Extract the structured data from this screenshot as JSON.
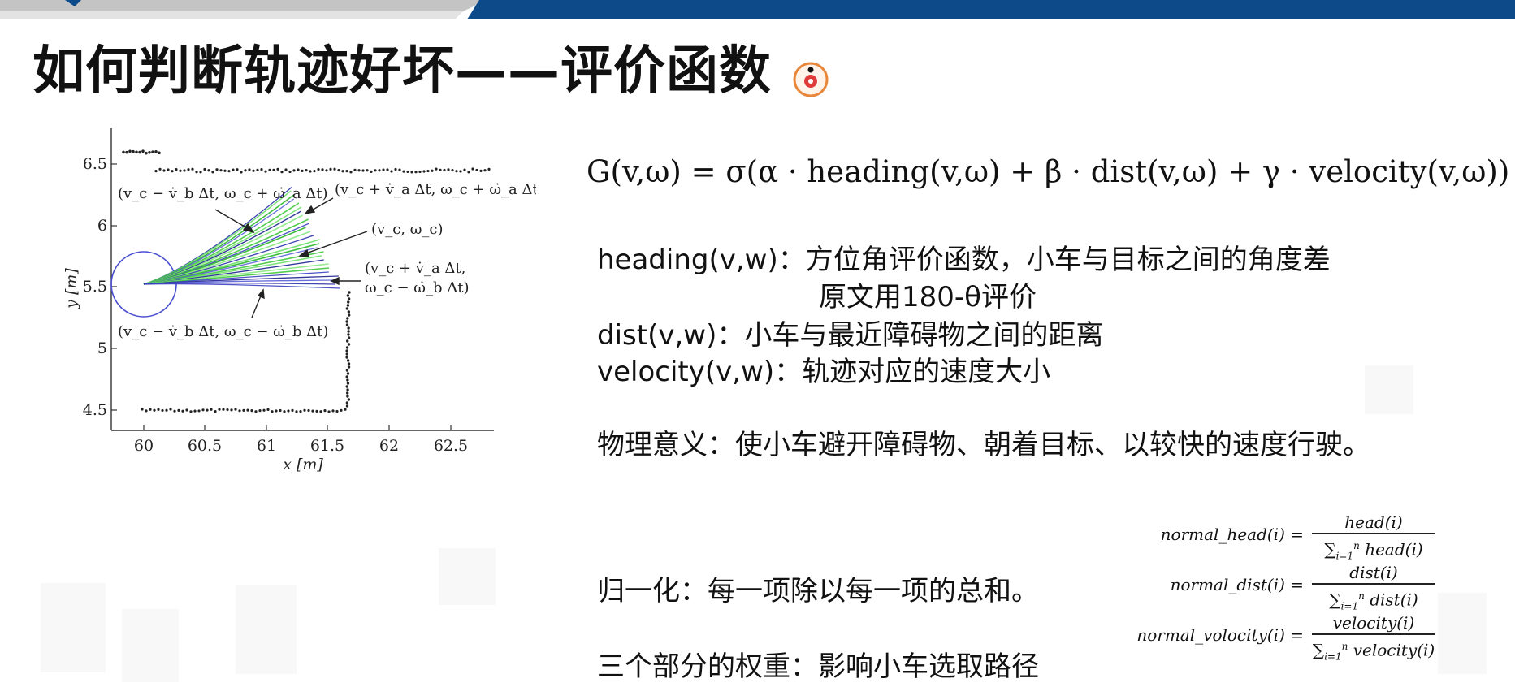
{
  "slide": {
    "title": "如何判断轨迹好坏——评价函数",
    "formula": "G(v,ω) = σ(α · heading(v,ω) + β · dist(v,ω) + γ · velocity(v,ω))",
    "items": [
      {
        "label": "heading(v,w)：方位角评价函数，小车与目标之间的角度差"
      },
      {
        "label": "原文用180-θ评价"
      },
      {
        "label": "dist(v,w)：小车与最近障碍物之间的距离"
      },
      {
        "label": "velocity(v,w)：轨迹对应的速度大小"
      }
    ],
    "meaning": "物理意义：使小车避开障碍物、朝着目标、以较快的速度行驶。",
    "normalize": "归一化：每一项除以每一项的总和。",
    "weights": "三个部分的权重：影响小车选取路径",
    "norm_formulas": [
      {
        "label": "normal_head(i) =",
        "num": "head(i)",
        "den_term": "head(i)"
      },
      {
        "label": "normal_dist(i) =",
        "num": "dist(i)",
        "den_term": "dist(i)"
      },
      {
        "label": "normal_volocity(i) =",
        "num": "velocity(i)",
        "den_term": "velocity(i)"
      }
    ]
  },
  "plot": {
    "xlabel": "x [m]",
    "ylabel": "y [m]",
    "xticks": [
      "60",
      "60.5",
      "61",
      "61.5",
      "62",
      "62.5"
    ],
    "yticks": [
      "6.5",
      "6",
      "5.5",
      "5",
      "4.5"
    ],
    "annotations": [
      "(v_c − v̇_b Δt, ω_c + ω̇_a Δt)",
      "(v_c + v̇_a Δt, ω_c + ω̇_a Δt)",
      "(v_c, ω_c)",
      "(v_c + v̇_a Δt,",
      "ω_c − ω̇_b Δt)",
      "(v_c − v̇_b Δt, ω_c − ω̇_b Δt)"
    ],
    "colors": {
      "blue": "#2a2fa8",
      "green": "#3fc83a",
      "obstacle": "#222222",
      "robot": "#4a4fd0"
    }
  },
  "theme": {
    "bar_blue": "#0d4a8a",
    "bar_gray": "#b8b8b8",
    "cursor": "#e8863a"
  }
}
